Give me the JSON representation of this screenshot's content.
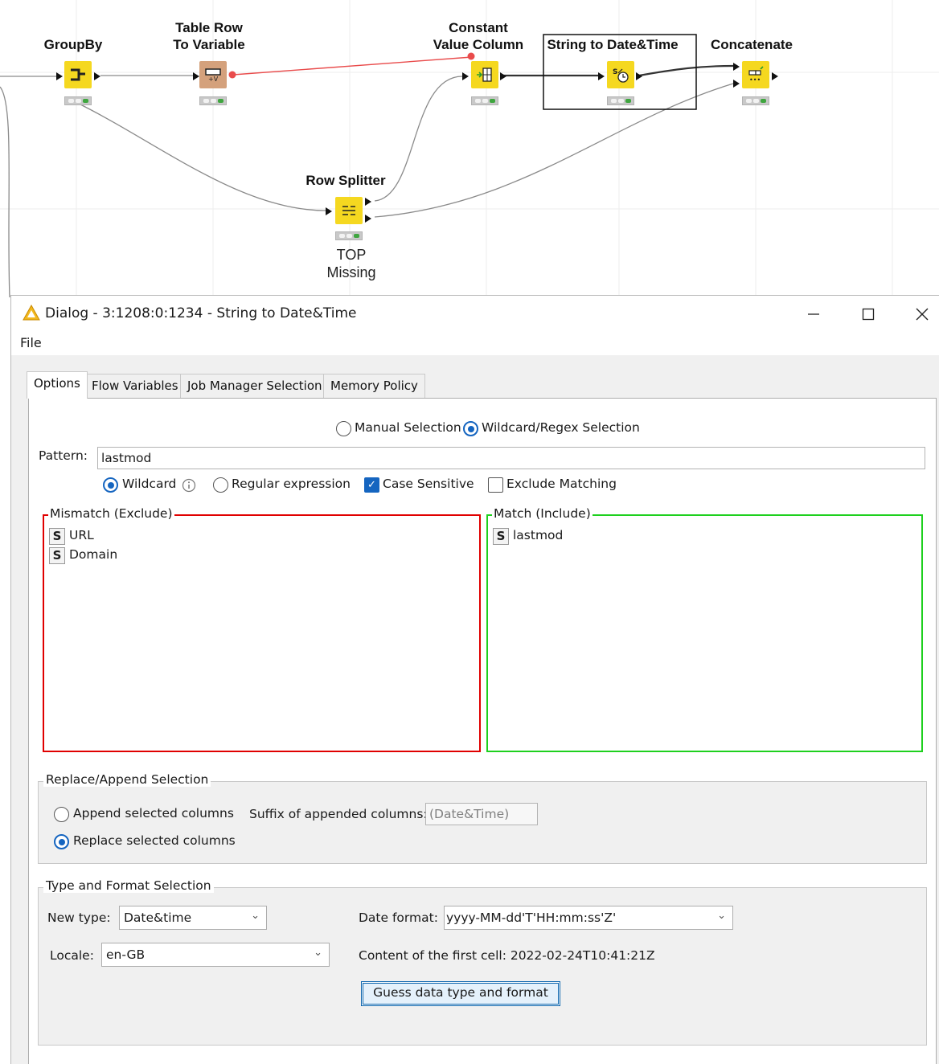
{
  "workflow": {
    "nodes": [
      {
        "id": "groupby",
        "label": "GroupBy",
        "icon": "groupby-icon"
      },
      {
        "id": "table_row_to_variable",
        "label": "Table Row\nTo Variable",
        "icon": "table-row-to-variable-icon"
      },
      {
        "id": "constant_value_column",
        "label": "Constant\nValue Column",
        "icon": "constant-value-column-icon"
      },
      {
        "id": "string_to_datetime",
        "label": "String to Date&Time",
        "icon": "string-to-datetime-icon",
        "selected": true
      },
      {
        "id": "concatenate",
        "label": "Concatenate",
        "icon": "concatenate-icon"
      },
      {
        "id": "row_splitter",
        "label": "Row Splitter",
        "icon": "row-splitter-icon",
        "annotation": "TOP\nMissing"
      }
    ],
    "colors": {
      "node_yellow": "#f5d820",
      "node_brown": "#d4a17c",
      "flow_variable_line": "#e94b4b",
      "connection": "#8a8a8a"
    }
  },
  "dialog": {
    "title": "Dialog - 3:1208:0:1234 - String to Date&Time",
    "menu": [
      "File"
    ],
    "tabs": [
      "Options",
      "Flow Variables",
      "Job Manager Selection",
      "Memory Policy"
    ],
    "active_tab": "Options",
    "selection_mode": {
      "manual_label": "Manual Selection",
      "wildcard_label": "Wildcard/Regex Selection",
      "selected": "Wildcard/Regex Selection"
    },
    "pattern": {
      "label": "Pattern:",
      "value": "lastmod"
    },
    "pattern_options": {
      "wildcard_label": "Wildcard",
      "regex_label": "Regular expression",
      "selected": "Wildcard",
      "case_sensitive_label": "Case Sensitive",
      "case_sensitive": true,
      "exclude_matching_label": "Exclude Matching",
      "exclude_matching": false
    },
    "exclude_list": {
      "title": "Mismatch (Exclude)",
      "items": [
        {
          "type": "S",
          "name": "URL"
        },
        {
          "type": "S",
          "name": "Domain"
        }
      ],
      "color": "#e00000"
    },
    "include_list": {
      "title": "Match (Include)",
      "items": [
        {
          "type": "S",
          "name": "lastmod"
        }
      ],
      "color": "#1ed01e"
    },
    "replace_append": {
      "title": "Replace/Append Selection",
      "append_label": "Append selected columns",
      "replace_label": "Replace selected columns",
      "selected": "Replace selected columns",
      "suffix_label": "Suffix of appended columns:",
      "suffix_value": "(Date&Time)"
    },
    "type_format": {
      "title": "Type and Format Selection",
      "new_type_label": "New type:",
      "new_type_value": "Date&time",
      "locale_label": "Locale:",
      "locale_value": "en-GB",
      "date_format_label": "Date format:",
      "date_format_value": "yyyy-MM-dd'T'HH:mm:ss'Z'",
      "first_cell_text": "Content of the first cell: 2022-02-24T10:41:21Z",
      "guess_button": "Guess data type and format"
    }
  }
}
